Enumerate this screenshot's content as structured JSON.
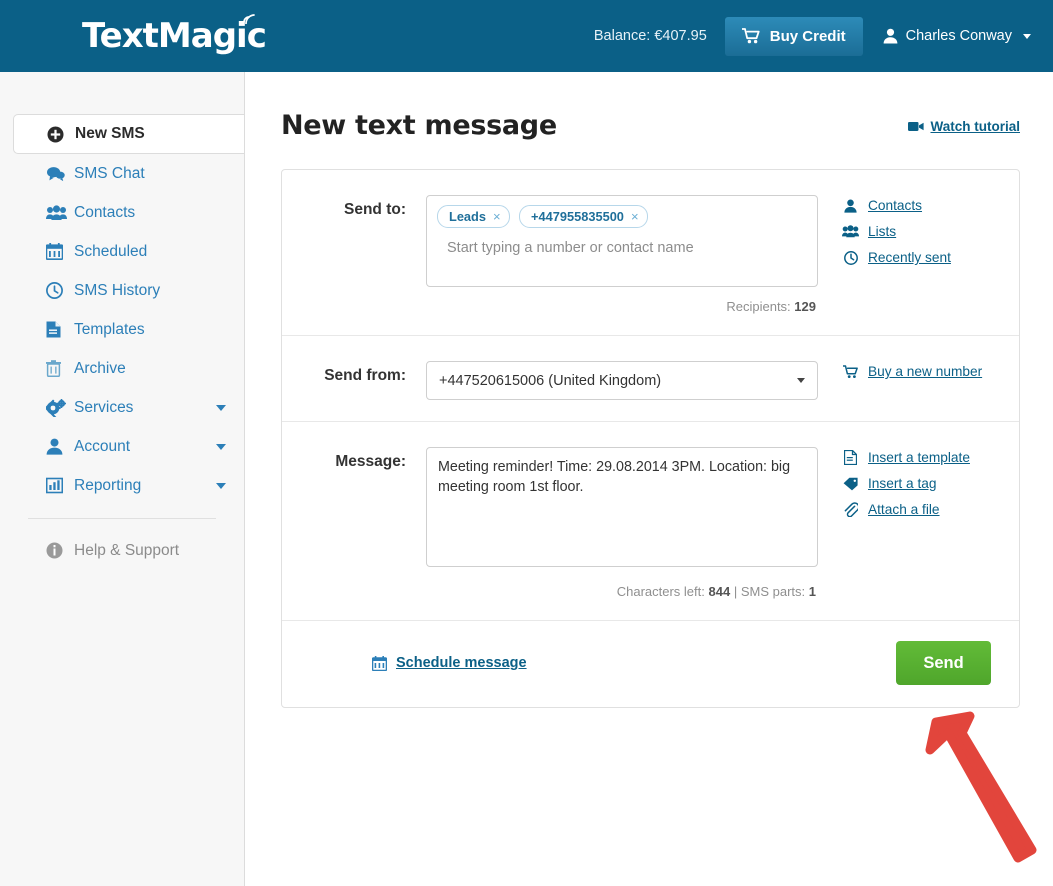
{
  "header": {
    "logo_text": "TextMagic",
    "logo_icon": "wifi-signal-icon",
    "balance_label": "Balance: €407.95",
    "buy_credit_label": "Buy Credit",
    "buy_credit_icon": "shopping-cart-icon",
    "user_name": "Charles Conway",
    "user_icon": "user-avatar-icon",
    "caret_icon": "caret-down-icon",
    "background_color": "#0b6087",
    "button_color": "#2d8bb8"
  },
  "sidebar": {
    "items": [
      {
        "label": "New SMS",
        "icon": "plus-circle-icon",
        "active": true,
        "expandable": false
      },
      {
        "label": "SMS Chat",
        "icon": "chat-bubble-icon",
        "active": false,
        "expandable": false
      },
      {
        "label": "Contacts",
        "icon": "people-group-icon",
        "active": false,
        "expandable": false
      },
      {
        "label": "Scheduled",
        "icon": "calendar-icon",
        "active": false,
        "expandable": false
      },
      {
        "label": "SMS History",
        "icon": "clock-icon",
        "active": false,
        "expandable": false
      },
      {
        "label": "Templates",
        "icon": "document-icon",
        "active": false,
        "expandable": false
      },
      {
        "label": "Archive",
        "icon": "trash-bin-icon",
        "active": false,
        "expandable": false
      },
      {
        "label": "Services",
        "icon": "gears-icon",
        "active": false,
        "expandable": true
      },
      {
        "label": "Account",
        "icon": "user-icon",
        "active": false,
        "expandable": true
      },
      {
        "label": "Reporting",
        "icon": "bar-chart-icon",
        "active": false,
        "expandable": true
      }
    ],
    "help": {
      "label": "Help & Support",
      "icon": "info-circle-icon"
    },
    "link_color": "#2c7fb8",
    "background_color": "#f7f7f7"
  },
  "main": {
    "title": "New text message",
    "watch_tutorial": {
      "label": "Watch tutorial",
      "icon": "video-camera-icon"
    },
    "send_to": {
      "label": "Send to:",
      "tokens": [
        {
          "text": "Leads",
          "remove_icon": "close-x-icon"
        },
        {
          "text": "+447955835500",
          "remove_icon": "close-x-icon"
        }
      ],
      "placeholder": "Start typing a number or contact name",
      "counter_prefix": "Recipients:",
      "counter_value": "129",
      "links": [
        {
          "label": "Contacts",
          "icon": "user-icon"
        },
        {
          "label": "Lists",
          "icon": "people-group-icon"
        },
        {
          "label": "Recently sent",
          "icon": "clock-icon"
        }
      ]
    },
    "send_from": {
      "label": "Send from:",
      "selected_option": "+447520615006 (United Kingdom)",
      "options": [
        "+447520615006 (United Kingdom)"
      ],
      "caret_icon": "caret-down-icon",
      "links": [
        {
          "label": "Buy a new number",
          "icon": "shopping-cart-icon"
        }
      ]
    },
    "message": {
      "label": "Message:",
      "value": "Meeting reminder! Time: 29.08.2014 3PM. Location: big meeting room 1st floor.",
      "counter_chars_prefix": "Characters left:",
      "counter_chars_value": "844",
      "counter_separator": "|",
      "counter_parts_prefix": "SMS parts:",
      "counter_parts_value": "1",
      "links": [
        {
          "label": "Insert a template",
          "icon": "document-icon"
        },
        {
          "label": "Insert a tag",
          "icon": "tag-icon"
        },
        {
          "label": "Attach a file",
          "icon": "paperclip-icon"
        }
      ]
    },
    "footer": {
      "schedule_label": "Schedule message",
      "schedule_icon": "calendar-icon",
      "send_label": "Send",
      "send_color": "#5cb334"
    }
  },
  "annotation": {
    "arrow_icon": "red-arrow-pointer",
    "arrow_color": "#e2453c",
    "points_to": "Send"
  }
}
